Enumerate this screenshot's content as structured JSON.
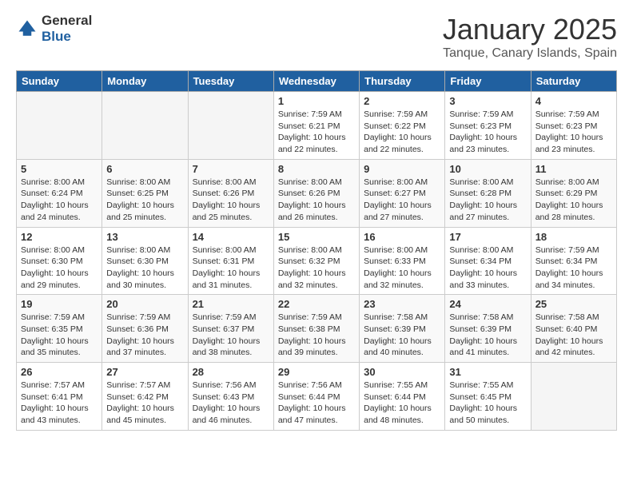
{
  "header": {
    "logo_general": "General",
    "logo_blue": "Blue",
    "title": "January 2025",
    "subtitle": "Tanque, Canary Islands, Spain"
  },
  "days_of_week": [
    "Sunday",
    "Monday",
    "Tuesday",
    "Wednesday",
    "Thursday",
    "Friday",
    "Saturday"
  ],
  "weeks": [
    [
      {
        "num": "",
        "info": "",
        "empty": true
      },
      {
        "num": "",
        "info": "",
        "empty": true
      },
      {
        "num": "",
        "info": "",
        "empty": true
      },
      {
        "num": "1",
        "info": "Sunrise: 7:59 AM\nSunset: 6:21 PM\nDaylight: 10 hours\nand 22 minutes."
      },
      {
        "num": "2",
        "info": "Sunrise: 7:59 AM\nSunset: 6:22 PM\nDaylight: 10 hours\nand 22 minutes."
      },
      {
        "num": "3",
        "info": "Sunrise: 7:59 AM\nSunset: 6:23 PM\nDaylight: 10 hours\nand 23 minutes."
      },
      {
        "num": "4",
        "info": "Sunrise: 7:59 AM\nSunset: 6:23 PM\nDaylight: 10 hours\nand 23 minutes."
      }
    ],
    [
      {
        "num": "5",
        "info": "Sunrise: 8:00 AM\nSunset: 6:24 PM\nDaylight: 10 hours\nand 24 minutes."
      },
      {
        "num": "6",
        "info": "Sunrise: 8:00 AM\nSunset: 6:25 PM\nDaylight: 10 hours\nand 25 minutes."
      },
      {
        "num": "7",
        "info": "Sunrise: 8:00 AM\nSunset: 6:26 PM\nDaylight: 10 hours\nand 25 minutes."
      },
      {
        "num": "8",
        "info": "Sunrise: 8:00 AM\nSunset: 6:26 PM\nDaylight: 10 hours\nand 26 minutes."
      },
      {
        "num": "9",
        "info": "Sunrise: 8:00 AM\nSunset: 6:27 PM\nDaylight: 10 hours\nand 27 minutes."
      },
      {
        "num": "10",
        "info": "Sunrise: 8:00 AM\nSunset: 6:28 PM\nDaylight: 10 hours\nand 27 minutes."
      },
      {
        "num": "11",
        "info": "Sunrise: 8:00 AM\nSunset: 6:29 PM\nDaylight: 10 hours\nand 28 minutes."
      }
    ],
    [
      {
        "num": "12",
        "info": "Sunrise: 8:00 AM\nSunset: 6:30 PM\nDaylight: 10 hours\nand 29 minutes."
      },
      {
        "num": "13",
        "info": "Sunrise: 8:00 AM\nSunset: 6:30 PM\nDaylight: 10 hours\nand 30 minutes."
      },
      {
        "num": "14",
        "info": "Sunrise: 8:00 AM\nSunset: 6:31 PM\nDaylight: 10 hours\nand 31 minutes."
      },
      {
        "num": "15",
        "info": "Sunrise: 8:00 AM\nSunset: 6:32 PM\nDaylight: 10 hours\nand 32 minutes."
      },
      {
        "num": "16",
        "info": "Sunrise: 8:00 AM\nSunset: 6:33 PM\nDaylight: 10 hours\nand 32 minutes."
      },
      {
        "num": "17",
        "info": "Sunrise: 8:00 AM\nSunset: 6:34 PM\nDaylight: 10 hours\nand 33 minutes."
      },
      {
        "num": "18",
        "info": "Sunrise: 7:59 AM\nSunset: 6:34 PM\nDaylight: 10 hours\nand 34 minutes."
      }
    ],
    [
      {
        "num": "19",
        "info": "Sunrise: 7:59 AM\nSunset: 6:35 PM\nDaylight: 10 hours\nand 35 minutes."
      },
      {
        "num": "20",
        "info": "Sunrise: 7:59 AM\nSunset: 6:36 PM\nDaylight: 10 hours\nand 37 minutes."
      },
      {
        "num": "21",
        "info": "Sunrise: 7:59 AM\nSunset: 6:37 PM\nDaylight: 10 hours\nand 38 minutes."
      },
      {
        "num": "22",
        "info": "Sunrise: 7:59 AM\nSunset: 6:38 PM\nDaylight: 10 hours\nand 39 minutes."
      },
      {
        "num": "23",
        "info": "Sunrise: 7:58 AM\nSunset: 6:39 PM\nDaylight: 10 hours\nand 40 minutes."
      },
      {
        "num": "24",
        "info": "Sunrise: 7:58 AM\nSunset: 6:39 PM\nDaylight: 10 hours\nand 41 minutes."
      },
      {
        "num": "25",
        "info": "Sunrise: 7:58 AM\nSunset: 6:40 PM\nDaylight: 10 hours\nand 42 minutes."
      }
    ],
    [
      {
        "num": "26",
        "info": "Sunrise: 7:57 AM\nSunset: 6:41 PM\nDaylight: 10 hours\nand 43 minutes."
      },
      {
        "num": "27",
        "info": "Sunrise: 7:57 AM\nSunset: 6:42 PM\nDaylight: 10 hours\nand 45 minutes."
      },
      {
        "num": "28",
        "info": "Sunrise: 7:56 AM\nSunset: 6:43 PM\nDaylight: 10 hours\nand 46 minutes."
      },
      {
        "num": "29",
        "info": "Sunrise: 7:56 AM\nSunset: 6:44 PM\nDaylight: 10 hours\nand 47 minutes."
      },
      {
        "num": "30",
        "info": "Sunrise: 7:55 AM\nSunset: 6:44 PM\nDaylight: 10 hours\nand 48 minutes."
      },
      {
        "num": "31",
        "info": "Sunrise: 7:55 AM\nSunset: 6:45 PM\nDaylight: 10 hours\nand 50 minutes."
      },
      {
        "num": "",
        "info": "",
        "empty": true
      }
    ]
  ]
}
